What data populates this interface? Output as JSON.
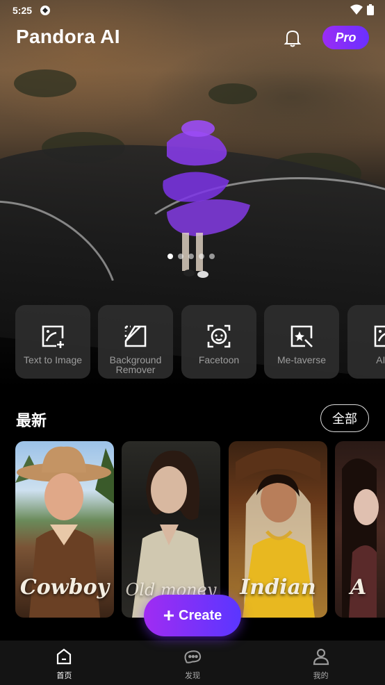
{
  "status_bar": {
    "time": "5:25"
  },
  "app": {
    "title": "Pandora AI",
    "pro_label": "Pro"
  },
  "carousel": {
    "page_count": 5,
    "active_index": 0
  },
  "tools": [
    {
      "label": "Text to Image",
      "icon": "text-to-image-icon"
    },
    {
      "label": "Background Remover",
      "icon": "background-remover-icon"
    },
    {
      "label": "Facetoon",
      "icon": "facetoon-icon"
    },
    {
      "label": "Me-taverse",
      "icon": "metaverse-icon"
    },
    {
      "label": "AI A",
      "icon": "ai-avatar-icon"
    }
  ],
  "latest": {
    "title": "最新",
    "all_label": "全部",
    "cards": [
      {
        "caption": "Cowboy"
      },
      {
        "caption": "Old money"
      },
      {
        "caption": "Indian"
      },
      {
        "caption": "A"
      }
    ]
  },
  "create_label": "Create",
  "bottom_nav": [
    {
      "label": "首页",
      "icon": "home-icon",
      "active": true
    },
    {
      "label": "发现",
      "icon": "discover-icon",
      "active": false
    },
    {
      "label": "我的",
      "icon": "profile-icon",
      "active": false
    }
  ],
  "colors": {
    "accent_start": "#9a2cf5",
    "accent_end": "#6a30ff",
    "tool_bg": "#2d2d2d",
    "nav_bg": "#141414"
  }
}
